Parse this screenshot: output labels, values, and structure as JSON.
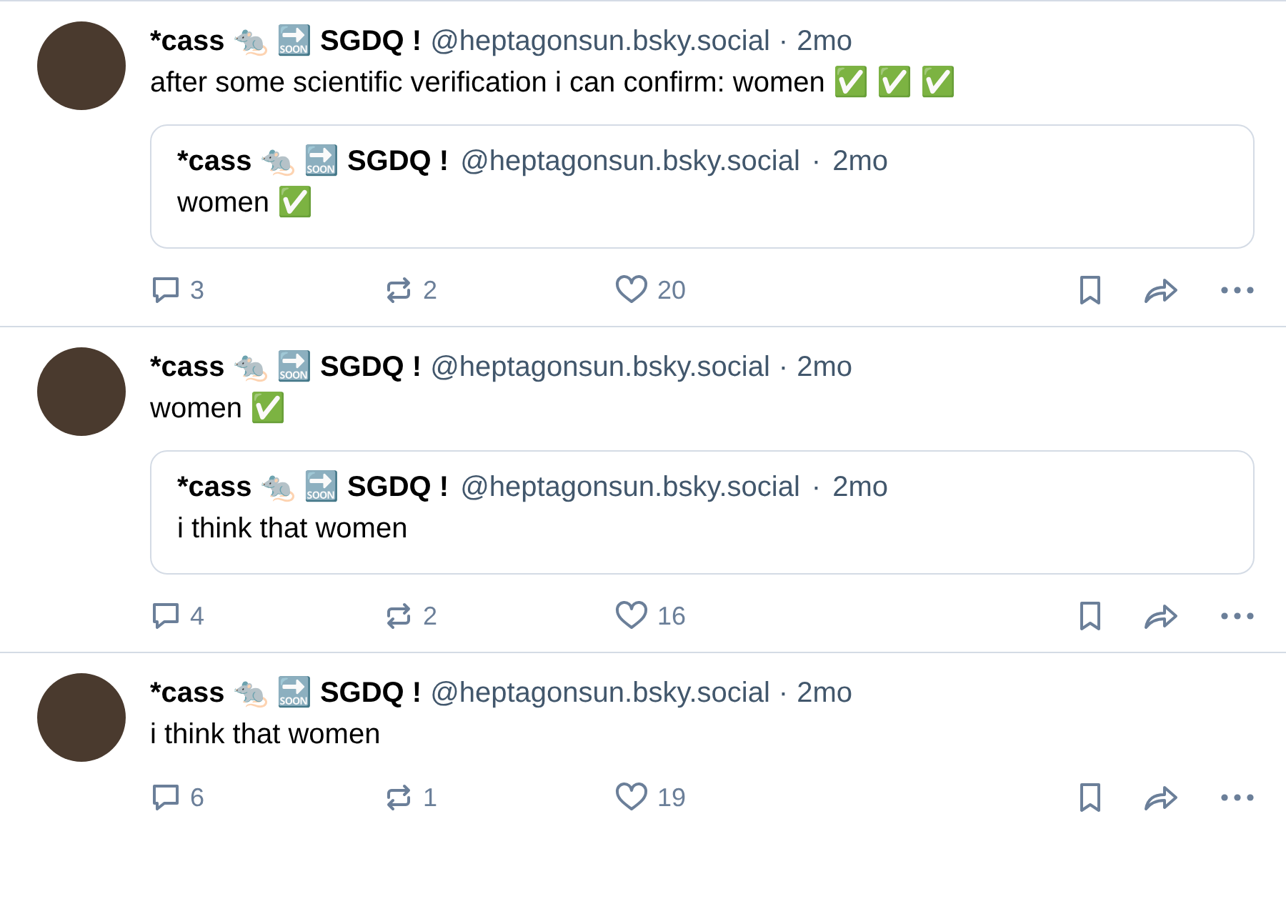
{
  "posts": [
    {
      "author": {
        "display_name": "*cass 🐀 🔜 SGDQ !",
        "handle": "@heptagonsun.bsky.social"
      },
      "separator": "·",
      "time": "2mo",
      "text": "after some scientific verification i can confirm: women ✅ ✅ ✅",
      "quote": {
        "author": {
          "display_name": "*cass 🐀 🔜 SGDQ !",
          "handle": "@heptagonsun.bsky.social"
        },
        "separator": "·",
        "time": "2mo",
        "text": "women ✅"
      },
      "replies": "3",
      "reposts": "2",
      "likes": "20"
    },
    {
      "author": {
        "display_name": "*cass 🐀 🔜 SGDQ !",
        "handle": "@heptagonsun.bsky.social"
      },
      "separator": "·",
      "time": "2mo",
      "text": "women ✅",
      "quote": {
        "author": {
          "display_name": "*cass 🐀 🔜 SGDQ !",
          "handle": "@heptagonsun.bsky.social"
        },
        "separator": "·",
        "time": "2mo",
        "text": "i think that women"
      },
      "replies": "4",
      "reposts": "2",
      "likes": "16"
    },
    {
      "author": {
        "display_name": "*cass 🐀 🔜 SGDQ !",
        "handle": "@heptagonsun.bsky.social"
      },
      "separator": "·",
      "time": "2mo",
      "text": "i think that women",
      "replies": "6",
      "reposts": "1",
      "likes": "19"
    }
  ]
}
